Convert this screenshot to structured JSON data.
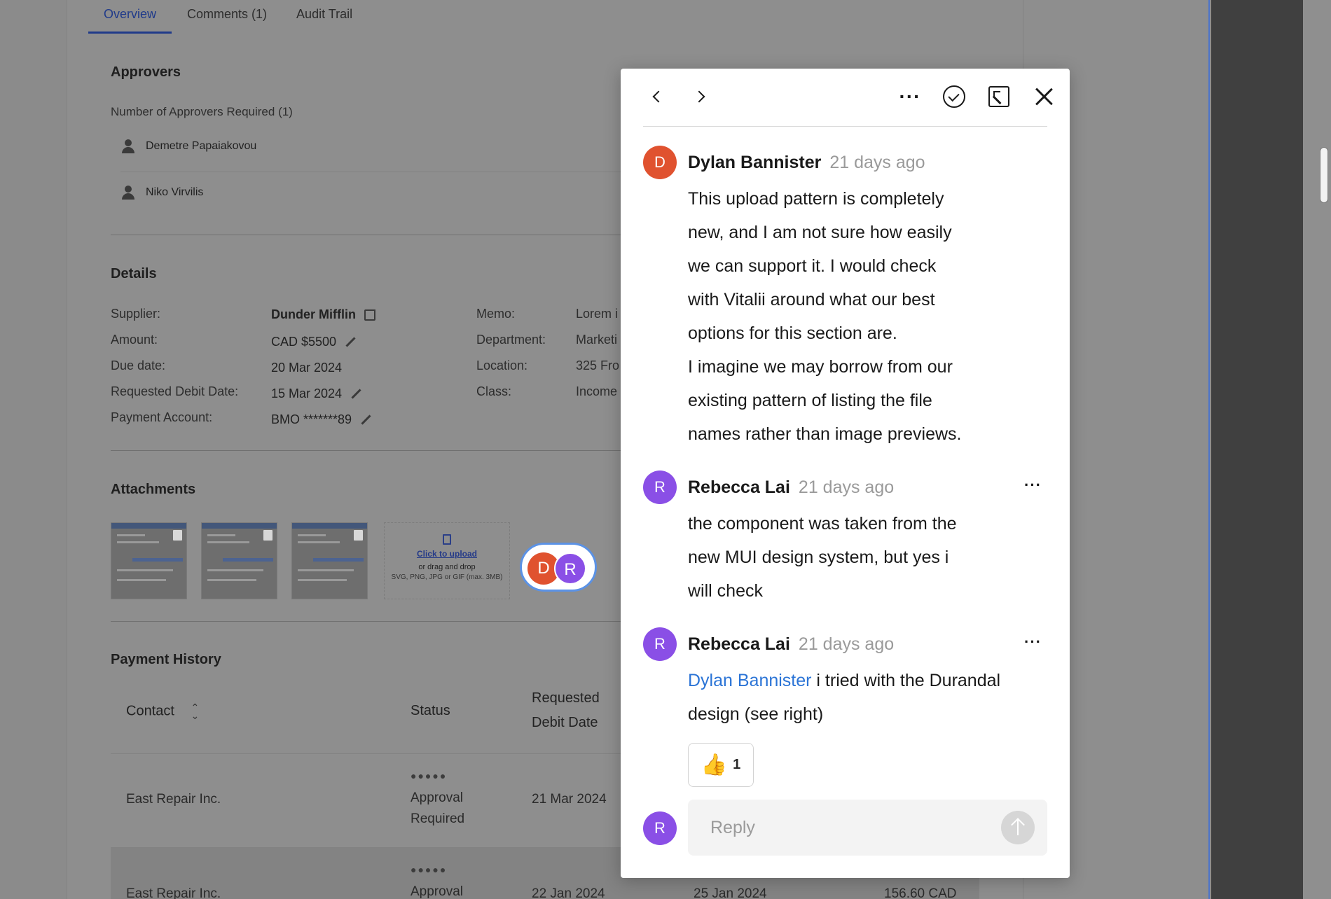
{
  "tabs": [
    {
      "label": "Overview"
    },
    {
      "label": "Comments (1)"
    },
    {
      "label": "Audit Trail"
    }
  ],
  "approvers": {
    "title": "Approvers",
    "required_label": "Number of Approvers Required (1)",
    "people": [
      "Demetre Papaiakovou",
      "Niko Virvilis"
    ]
  },
  "details": {
    "title": "Details",
    "fields_left": [
      {
        "label": "Supplier:",
        "value": "Dunder Mifflin"
      },
      {
        "label": "Amount:",
        "value": "CAD $5500"
      },
      {
        "label": "Due date:",
        "value": "20 Mar 2024"
      },
      {
        "label": "Requested Debit Date:",
        "value": "15 Mar 2024"
      },
      {
        "label": "Payment Account:",
        "value": "BMO *******89"
      }
    ],
    "fields_right": [
      {
        "label": "Memo:",
        "value": "Lorem i"
      },
      {
        "label": "Department:",
        "value": "Marketi"
      },
      {
        "label": "Location:",
        "value": "325 Fro"
      },
      {
        "label": "Class:",
        "value": "Income"
      }
    ]
  },
  "attachments": {
    "title": "Attachments",
    "upload": {
      "link": "Click to upload",
      "hint": "or drag and drop",
      "formats": "SVG, PNG, JPG or GIF (max. 3MB)"
    },
    "avatars": [
      "D",
      "R"
    ]
  },
  "payment_history": {
    "title": "Payment History",
    "columns": [
      "Contact",
      "Status",
      "Requested",
      "Debit Date"
    ],
    "rows": [
      {
        "contact": "East Repair Inc.",
        "status_line1": "Approval",
        "status_line2": "Required",
        "date": "21 Mar 2024",
        "date2": "",
        "amount": ""
      },
      {
        "contact": "East Repair Inc.",
        "status_line1": "Approval",
        "status_line2": "",
        "date": "22 Jan 2024",
        "date2": "25 Jan 2024",
        "amount": "156.60 CAD"
      }
    ]
  },
  "comments": [
    {
      "initial": "D",
      "color": "#e0522f",
      "author": "Dylan Bannister",
      "time": "21 days ago",
      "lines": [
        "This upload pattern is completely",
        "new, and I am not sure how easily",
        "we can support it. I would check",
        "with Vitalii around what our best",
        "options for this section are.",
        "I imagine we may borrow from our",
        "existing pattern of listing the file",
        "names rather than image previews."
      ]
    },
    {
      "initial": "R",
      "color": "#8a4fe6",
      "author": "Rebecca Lai",
      "time": "21 days ago",
      "lines": [
        "the component was taken from the",
        "new MUI design system, but yes i",
        "will check"
      ]
    },
    {
      "initial": "R",
      "color": "#8a4fe6",
      "author": "Rebecca Lai",
      "time": "21 days ago",
      "mention": "Dylan Bannister",
      "line1_rest": " i tried with the Durandal",
      "line2": "design (see right)"
    }
  ],
  "reaction": {
    "emoji": "👍",
    "count": "1"
  },
  "reply": {
    "initial": "R",
    "placeholder": "Reply"
  }
}
